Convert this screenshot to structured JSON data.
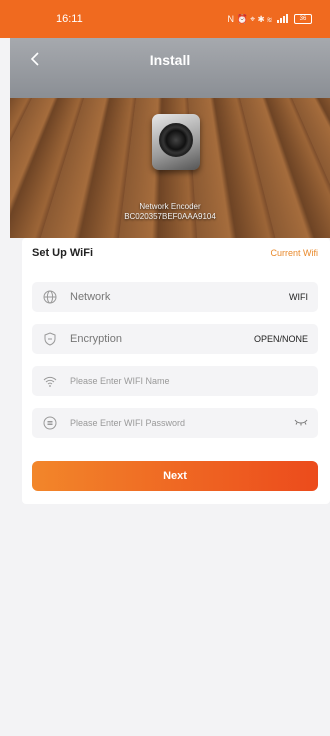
{
  "status_bar": {
    "time": "16:11",
    "indicators": "N ⏰ ⌖ ✱ ≋",
    "battery": "36"
  },
  "header": {
    "title": "Install",
    "back_icon": "chevron-left-icon"
  },
  "device": {
    "name": "Network Encoder",
    "id": "BC020357BEF0AAA9104"
  },
  "wifi": {
    "section_title": "Set Up WiFi",
    "current_wifi_link": "Current Wifi",
    "network_label": "Network",
    "network_value": "WIFI",
    "encryption_label": "Encryption",
    "encryption_value": "OPEN/NONE",
    "name_placeholder": "Please Enter WIFI Name",
    "password_placeholder": "Please Enter WIFI Password",
    "next_label": "Next"
  },
  "colors": {
    "accent": "#f06a1f",
    "link": "#e9892b",
    "button_start": "#f2862a",
    "button_end": "#ec4b1c"
  }
}
